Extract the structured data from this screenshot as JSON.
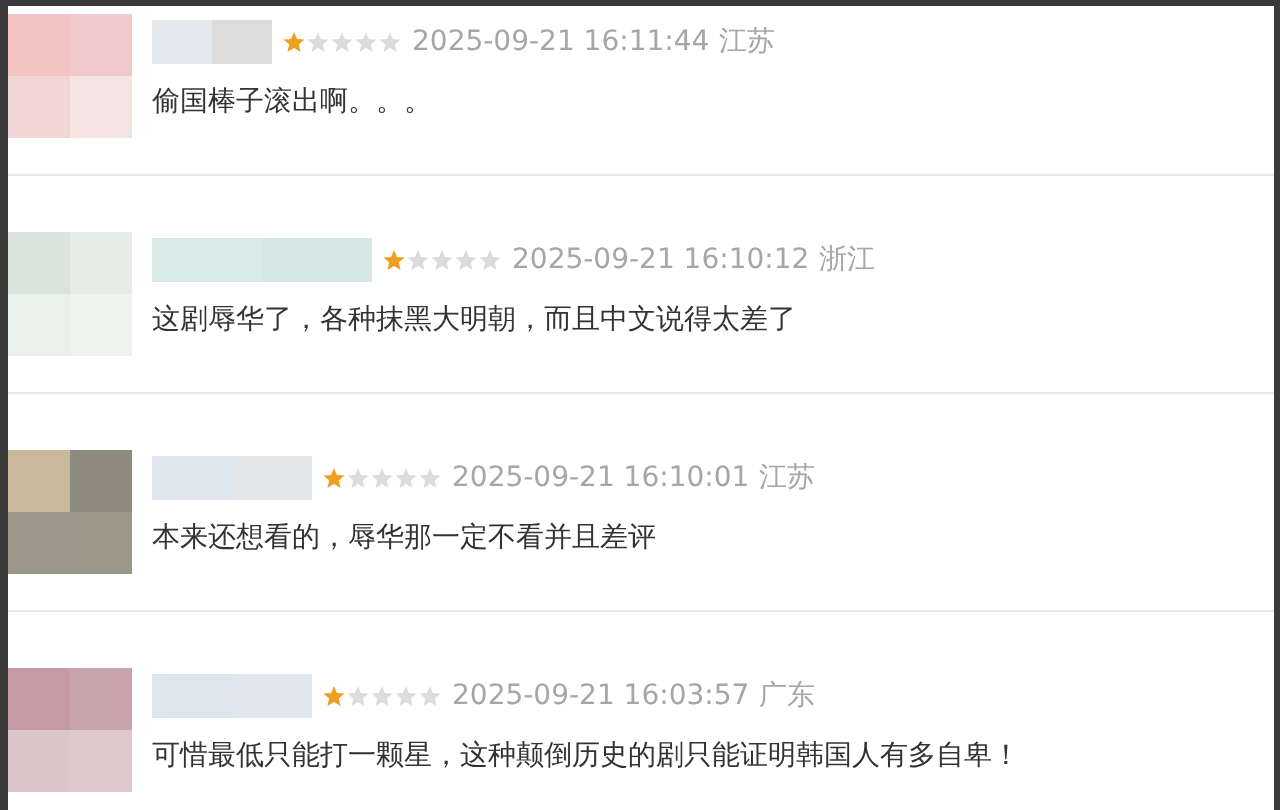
{
  "comments": [
    {
      "stars": 1,
      "time": "2025-09-21 16:11:44",
      "location": "江苏",
      "text": "偷国棒子滚出啊。。。"
    },
    {
      "stars": 1,
      "time": "2025-09-21 16:10:12",
      "location": "浙江",
      "text": "这剧辱华了，各种抹黑大明朝，而且中文说得太差了"
    },
    {
      "stars": 1,
      "time": "2025-09-21 16:10:01",
      "location": "江苏",
      "text": "本来还想看的，辱华那一定不看并且差评"
    },
    {
      "stars": 1,
      "time": "2025-09-21 16:03:57",
      "location": "广东",
      "text": "可惜最低只能打一颗星，这种颠倒历史的剧只能证明韩国人有多自卑！"
    }
  ]
}
